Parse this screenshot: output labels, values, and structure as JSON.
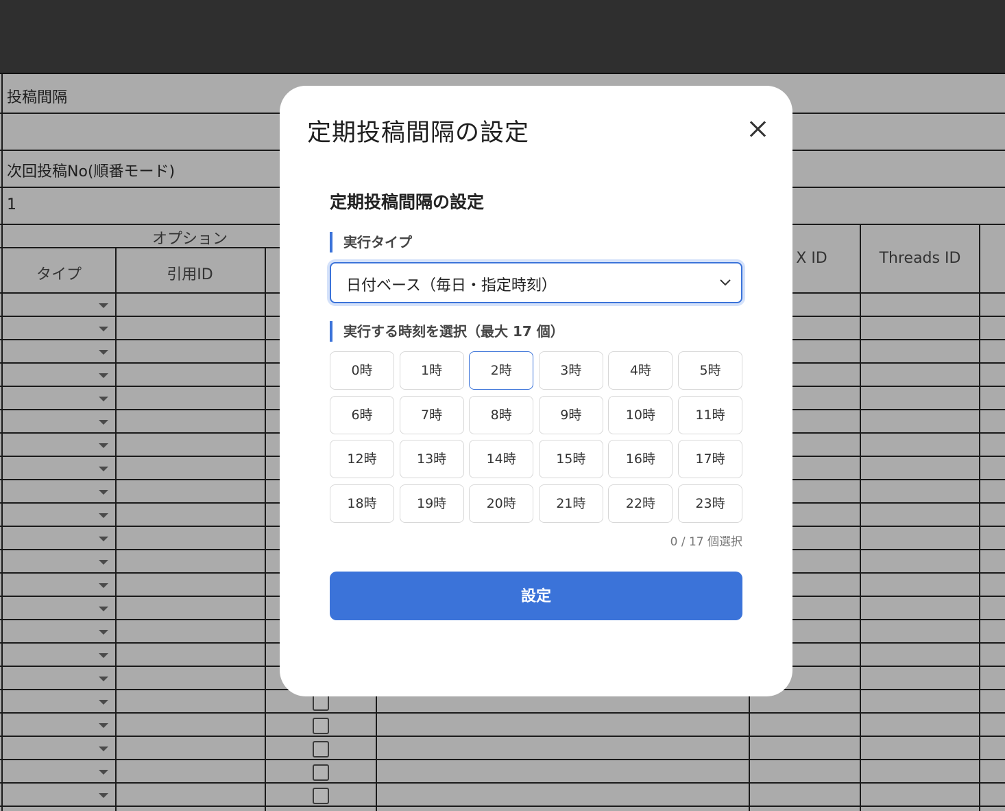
{
  "sheet": {
    "row_posting_interval": "投稿間隔",
    "row_next_post_no": "次回投稿No(順番モード)",
    "next_post_no_value": "1",
    "options_header": "オプション",
    "col_type": "タイプ",
    "col_quote_id": "引用ID",
    "col_x_id": "X ID",
    "col_threads_id": "Threads ID"
  },
  "modal": {
    "title": "定期投稿間隔の設定",
    "section_title": "定期投稿間隔の設定",
    "exec_type_label": "実行タイプ",
    "exec_type_value": "日付ベース（毎日・指定時刻）",
    "time_select_label": "実行する時刻を選択（最大 17 個）",
    "hours": [
      "0時",
      "1時",
      "2時",
      "3時",
      "4時",
      "5時",
      "6時",
      "7時",
      "8時",
      "9時",
      "10時",
      "11時",
      "12時",
      "13時",
      "14時",
      "15時",
      "16時",
      "17時",
      "18時",
      "19時",
      "20時",
      "21時",
      "22時",
      "23時"
    ],
    "selected_count": "0 / 17 個選択",
    "submit_label": "設定"
  },
  "colors": {
    "accent": "#3b73d9",
    "overlay": "#ababab",
    "topbar": "#2f2f2f"
  }
}
